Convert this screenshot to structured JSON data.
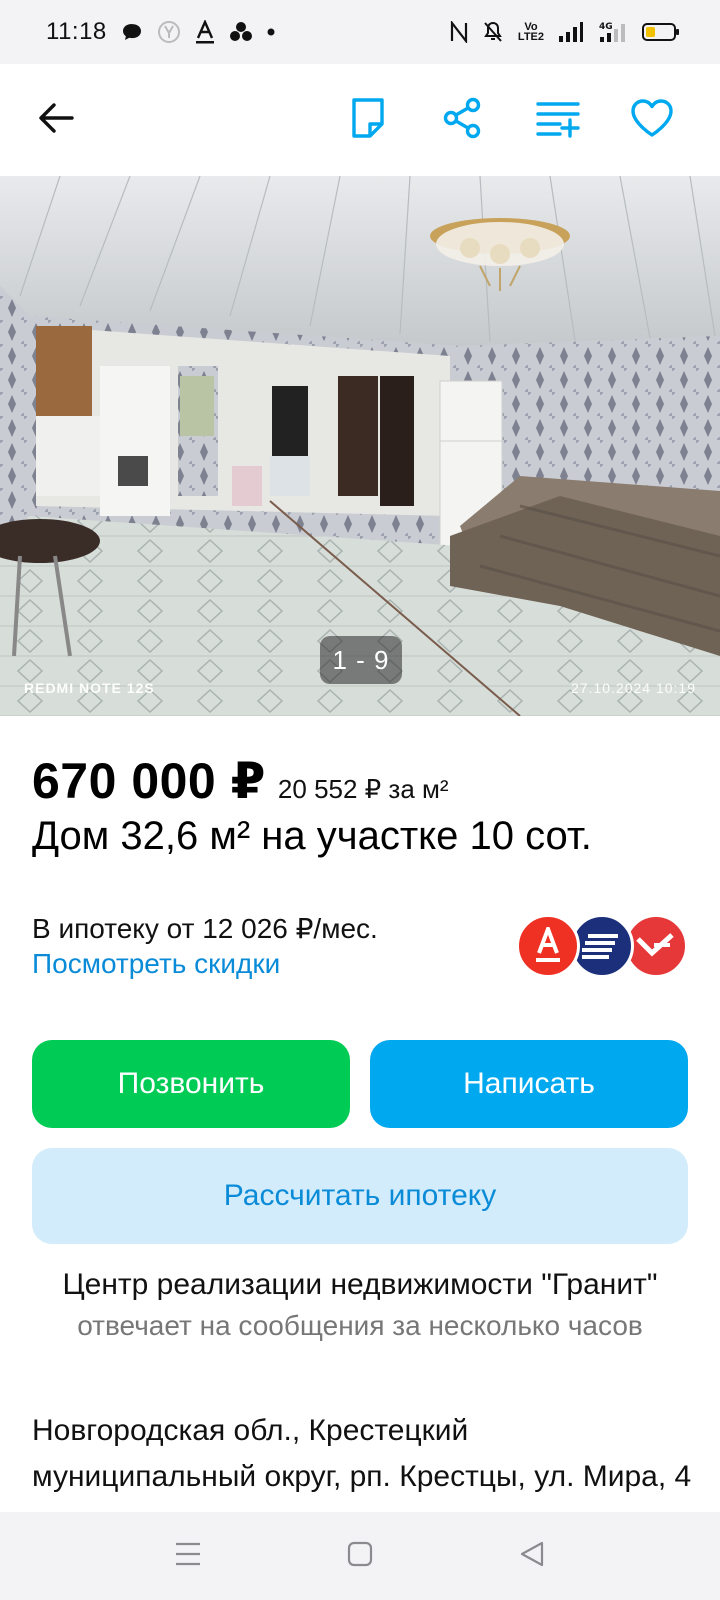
{
  "status_bar": {
    "time": "11:18",
    "network_label": "4G",
    "volte_label": "VoLTE2"
  },
  "app_bar": {
    "back_icon": "arrow-left-icon",
    "note_icon": "note-icon",
    "share_icon": "share-icon",
    "compare_icon": "compare-list-icon",
    "favorite_icon": "heart-icon",
    "accent_color": "#00a8f0"
  },
  "gallery": {
    "counter": "1 - 9",
    "watermark_device": "REDMI NOTE 12S",
    "watermark_datetime": "27.10.2024  10:19"
  },
  "listing": {
    "price": "670 000 ₽",
    "price_per_m2": "20 552 ₽ за м²",
    "title": "Дом 32,6 м² на участке 10 сот.",
    "mortgage_text": "В ипотеку от 12 026 ₽/мес.",
    "discounts_link": "Посмотреть скидки",
    "banks": [
      "alfa-bank-logo",
      "sovcombank-logo",
      "pochta-bank-logo"
    ]
  },
  "actions": {
    "call": "Позвонить",
    "write": "Написать",
    "calc_mortgage": "Рассчитать ипотеку",
    "call_color": "#00cc55",
    "write_color": "#00a8f0"
  },
  "seller": {
    "name": "Центр реализации недвижимости \"Гранит\"",
    "reply_time": "отвечает на сообщения за несколько часов"
  },
  "address": "Новгородская обл., Крестецкий муниципальный округ, рп. Крестцы, ул. Мира, 4",
  "nav_bar": {
    "menu_icon": "menu-icon",
    "home_icon": "home-square-icon",
    "back_icon": "back-triangle-icon"
  }
}
